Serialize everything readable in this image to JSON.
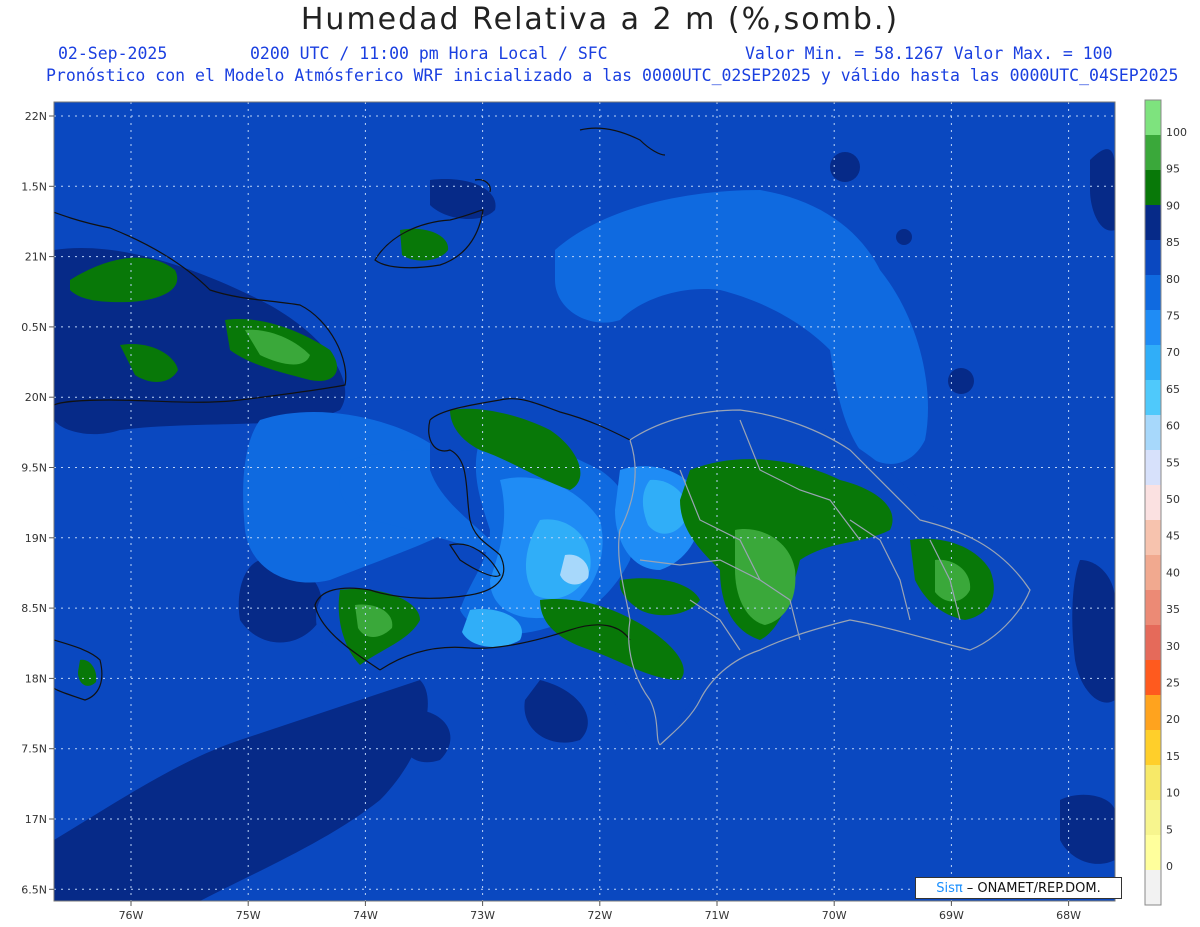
{
  "header": {
    "title": "Humedad Relativa a 2 m (%,somb.)",
    "date": "02-Sep-2025",
    "time": "0200 UTC / 11:00 pm Hora Local / SFC",
    "minmax": "Valor Min. = 58.1267  Valor Max. = 100",
    "description": "Pronóstico con el Modelo Atmósferico WRF inicializado a las 0000UTC_02SEP2025 y válido hasta las  0000UTC_04SEP2025"
  },
  "map": {
    "latitude_labels": [
      "22N",
      "1.5N",
      "21N",
      "0.5N",
      "20N",
      "9.5N",
      "19N",
      "8.5N",
      "18N",
      "7.5N",
      "17N",
      "6.5N"
    ],
    "longitude_labels": [
      "76W",
      "75W",
      "74W",
      "73W",
      "72W",
      "71W",
      "70W",
      "69W",
      "68W"
    ]
  },
  "legend": {
    "labels": [
      "100",
      "95",
      "90",
      "85",
      "80",
      "75",
      "70",
      "65",
      "60",
      "55",
      "50",
      "45",
      "40",
      "35",
      "30",
      "25",
      "20",
      "15",
      "10",
      "5",
      "0"
    ],
    "colors": [
      "#7ee37e",
      "#3aa83a",
      "#087808",
      "#062a88",
      "#0a48c0",
      "#0f6ae0",
      "#1f8cf5",
      "#30aef8",
      "#4fc9fb",
      "#a7d8fb",
      "#d7e1fb",
      "#fbe1e1",
      "#f7c3ae",
      "#f1a98f",
      "#ec8a75",
      "#e56a5a",
      "#ff5a1e",
      "#ffa31e",
      "#ffcf2a",
      "#f7e968",
      "#f7f58e",
      "#ffff9c",
      "#f2f2f2"
    ]
  },
  "credit": {
    "logo": "Sisπ",
    "org": "– ONAMET/REP.DOM."
  }
}
